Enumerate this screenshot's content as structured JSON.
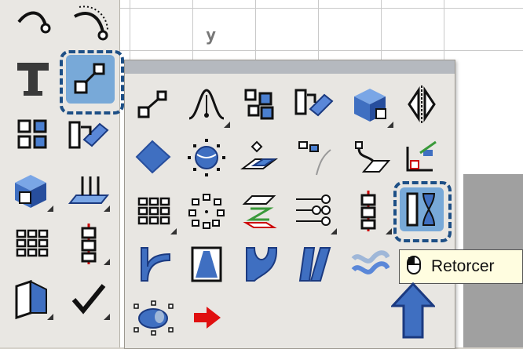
{
  "viewport": {
    "axis_label": "y"
  },
  "left_toolbar": {
    "tools": [
      {
        "name": "curve-tool-icon"
      },
      {
        "name": "arc-tool-icon"
      },
      {
        "name": "text-tool-icon"
      },
      {
        "name": "transform-tool-icon",
        "selected": true
      },
      {
        "name": "array-tool-icon"
      },
      {
        "name": "scale-tool-icon"
      },
      {
        "name": "solid-box-tool-icon"
      },
      {
        "name": "project-tool-icon"
      },
      {
        "name": "grid-array-tool-icon"
      },
      {
        "name": "red-chain-tool-icon"
      },
      {
        "name": "solid-panel-tool-icon"
      },
      {
        "name": "check-tool-icon"
      }
    ]
  },
  "flyout": {
    "title": "",
    "rows": [
      [
        "move-icon",
        "bend-icon",
        "copy-icon",
        "scale-1d-icon",
        "box-edit-icon",
        "mirror-icon"
      ],
      [
        "rotate-icon",
        "sphere-orient-icon",
        "orient-icon",
        "extend-icon",
        "flow-icon",
        "align-icon"
      ],
      [
        "rect-array-icon",
        "polar-array-icon",
        "stack-icon",
        "array-curve-icon",
        "chain-array-icon",
        "twist-icon"
      ],
      [
        "bend-profile-icon",
        "taper-icon",
        "shear-icon",
        "skew-icon",
        "wave-icon",
        ""
      ],
      [
        "cage-edit-icon",
        "arrow-right-icon"
      ]
    ]
  },
  "tooltip": {
    "label": "Retorcer",
    "icon": "mouse-icon"
  },
  "colors": {
    "highlight": "#1d4f86",
    "tool_blue": "#3f6fc1",
    "tooltip_bg": "#fffde0"
  }
}
